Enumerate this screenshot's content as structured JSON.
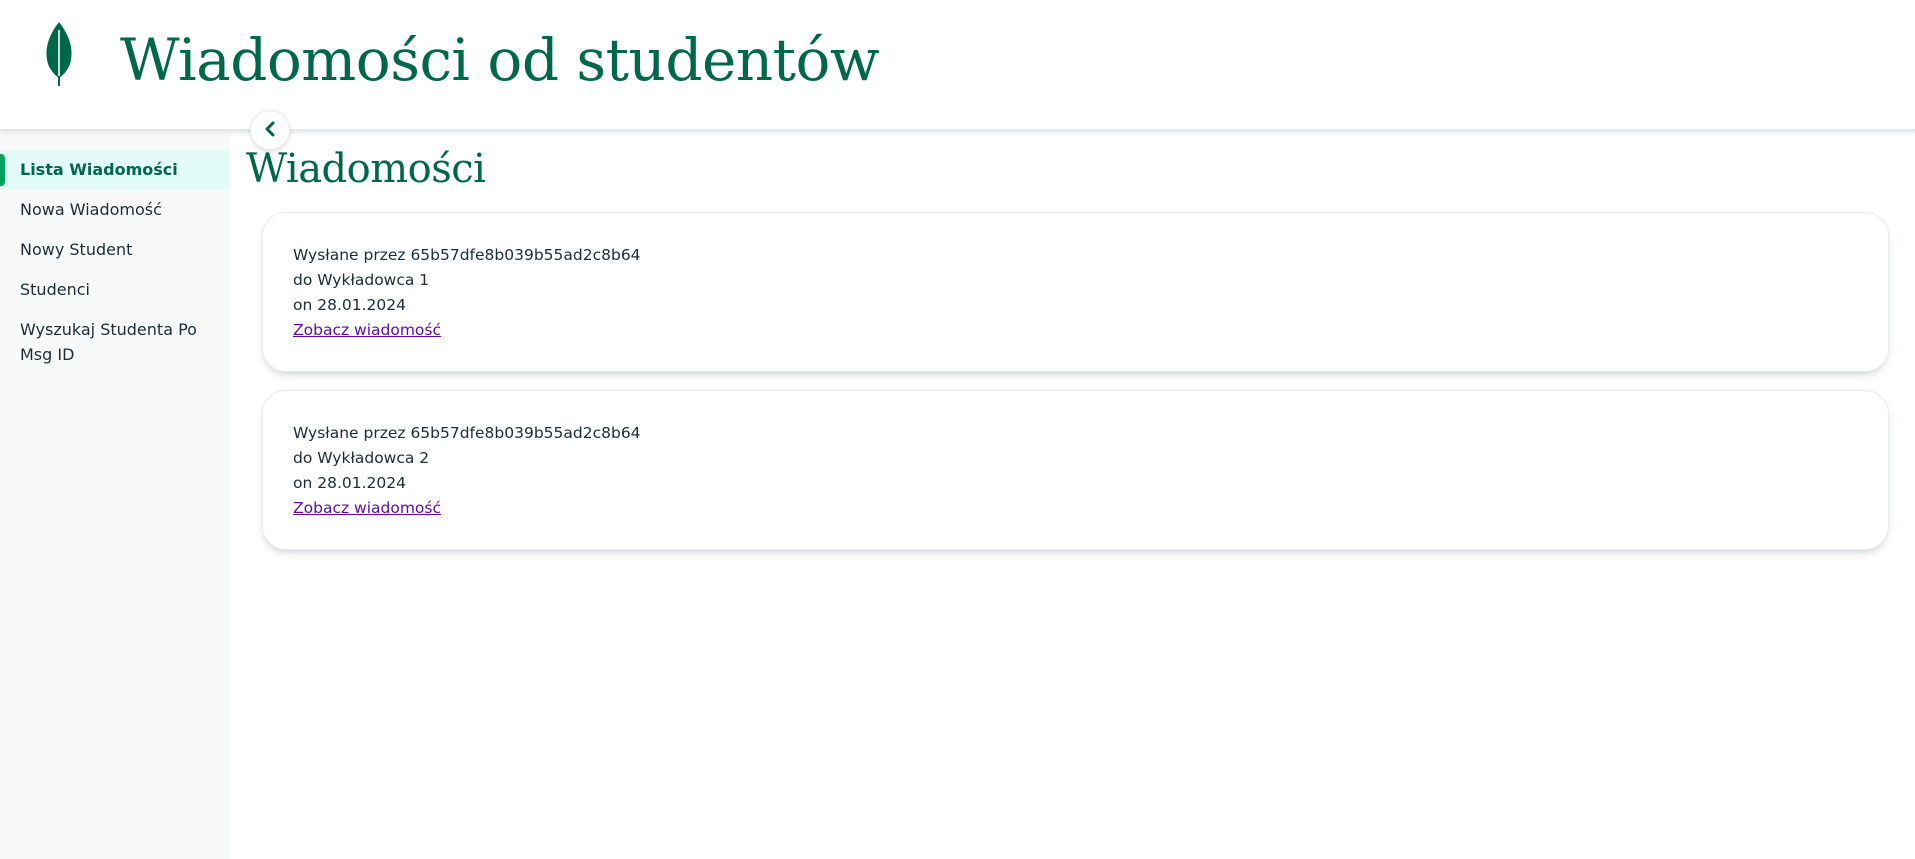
{
  "header": {
    "logo_icon": "leaf-logo-icon",
    "title": "Wiadomości od studentów",
    "brand_color": "#00684a"
  },
  "sidebar": {
    "collapse_icon": "chevron-left-icon",
    "items": [
      {
        "label": "Lista Wiadomości",
        "active": true
      },
      {
        "label": "Nowa Wiadomość",
        "active": false
      },
      {
        "label": "Nowy Student",
        "active": false
      },
      {
        "label": "Studenci",
        "active": false
      },
      {
        "label": "Wyszukaj Studenta Po Msg ID",
        "active": false
      }
    ]
  },
  "main": {
    "title": "Wiadomości",
    "messages": [
      {
        "sender": "Wysłane przez 65b57dfe8b039b55ad2c8b64",
        "recipient": "do Wykładowca 1",
        "date": "on 28.01.2024",
        "link_label": "Zobacz wiadomość"
      },
      {
        "sender": "Wysłane przez 65b57dfe8b039b55ad2c8b64",
        "recipient": "do Wykładowca 2",
        "date": "on 28.01.2024",
        "link_label": "Zobacz wiadomość"
      }
    ]
  }
}
